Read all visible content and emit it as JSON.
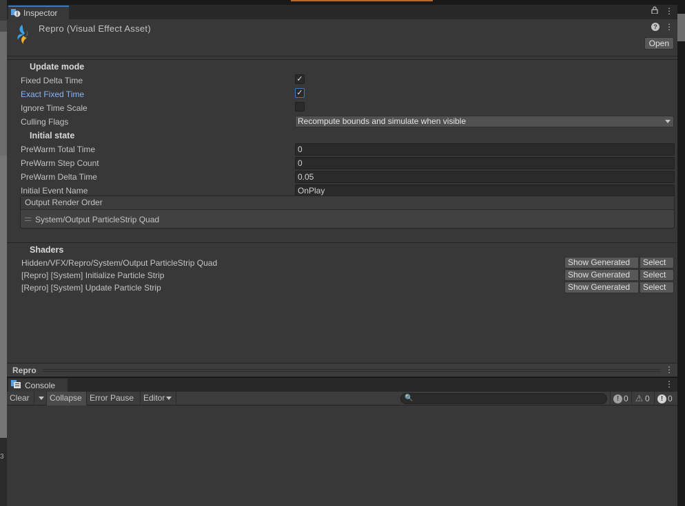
{
  "inspector": {
    "tab_label": "Inspector",
    "asset_title": "Repro (Visual Effect Asset)",
    "open_label": "Open",
    "update_mode": {
      "title": "Update mode",
      "fixed_delta_label": "Fixed Delta Time",
      "fixed_delta_checked": true,
      "exact_fixed_label": "Exact Fixed Time",
      "exact_fixed_checked": true,
      "ignore_scale_label": "Ignore Time Scale",
      "ignore_scale_checked": false,
      "culling_label": "Culling Flags",
      "culling_value": "Recompute bounds and simulate when visible"
    },
    "initial_state": {
      "title": "Initial state",
      "prewarm_total_label": "PreWarm Total Time",
      "prewarm_total_value": "0",
      "prewarm_step_label": "PreWarm Step Count",
      "prewarm_step_value": "0",
      "prewarm_delta_label": "PreWarm Delta Time",
      "prewarm_delta_value": "0.05",
      "initial_event_label": "Initial Event Name",
      "initial_event_value": "OnPlay"
    },
    "output_order": {
      "header": "Output Render Order",
      "item": "System/Output ParticleStrip Quad"
    },
    "shaders": {
      "title": "Shaders",
      "show_generated_label": "Show Generated",
      "select_label": "Select",
      "rows": [
        "Hidden/VFX/Repro/System/Output ParticleStrip Quad",
        "[Repro] [System] Initialize Particle Strip",
        "[Repro] [System] Update Particle Strip"
      ]
    },
    "footer_title": "Repro"
  },
  "console": {
    "tab_label": "Console",
    "clear_label": "Clear",
    "collapse_label": "Collapse",
    "error_pause_label": "Error Pause",
    "editor_label": "Editor",
    "info_count": "0",
    "warning_count": "0",
    "error_count": "0"
  },
  "scene": {
    "edge_number": "3"
  },
  "colors": {
    "accent": "#3a79bb",
    "link_label": "#8ab4f8",
    "panel_bg": "#383838"
  }
}
